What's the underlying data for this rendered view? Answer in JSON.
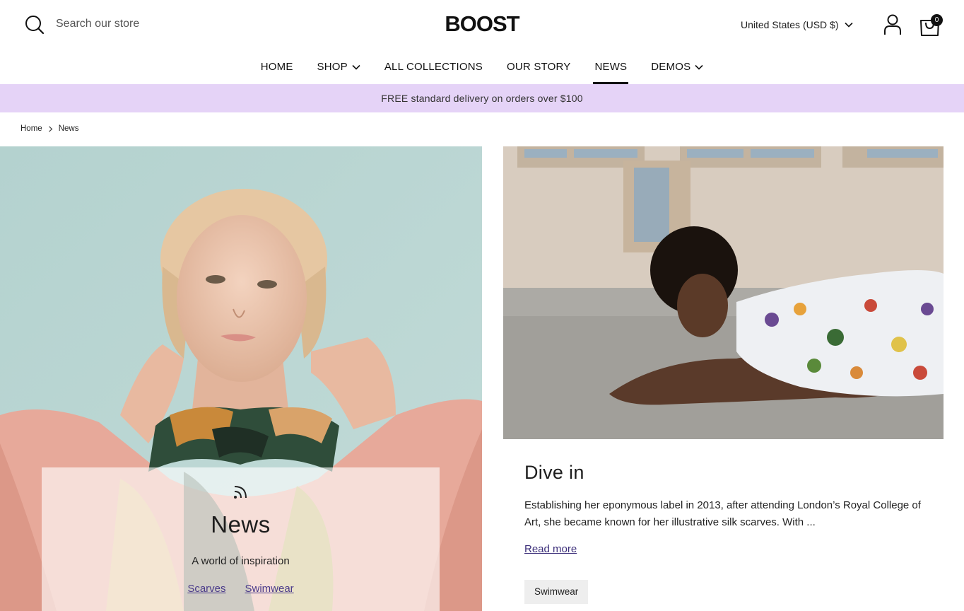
{
  "header": {
    "search_label": "Search our store",
    "logo": "BOOST",
    "currency": "United States (USD $)",
    "cart_count": "0"
  },
  "nav": {
    "items": [
      {
        "label": "HOME",
        "dropdown": false
      },
      {
        "label": "SHOP",
        "dropdown": true
      },
      {
        "label": "ALL COLLECTIONS",
        "dropdown": false
      },
      {
        "label": "OUR STORY",
        "dropdown": false
      },
      {
        "label": "NEWS",
        "dropdown": false,
        "active": true
      },
      {
        "label": "DEMOS",
        "dropdown": true
      }
    ]
  },
  "announcement": "FREE standard delivery on orders over $100",
  "breadcrumb": {
    "home": "Home",
    "current": "News"
  },
  "hero": {
    "title": "News",
    "subtitle": "A world of inspiration",
    "tags": [
      "Scarves",
      "Swimwear"
    ]
  },
  "article": {
    "title": "Dive in",
    "excerpt": "Establishing her eponymous label in 2013, after attending London’s Royal College of Art, she became known for her illustrative silk scarves. With ...",
    "read_more": "Read more",
    "tag": "Swimwear"
  },
  "colors": {
    "announcement_bg": "#e5d3f7",
    "link": "#4a3a8a",
    "text": "#1d1d1d"
  }
}
